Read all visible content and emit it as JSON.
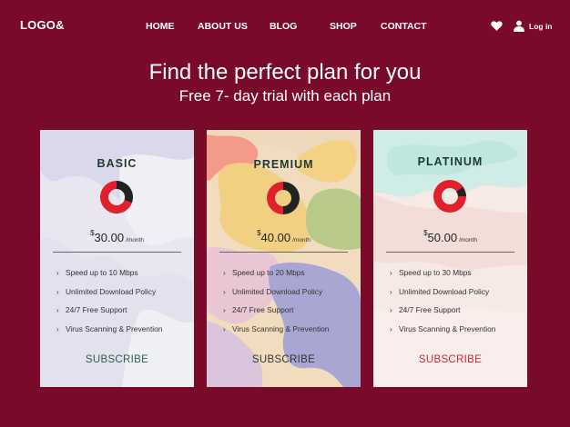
{
  "nav": {
    "logo": "LOGO&",
    "items": [
      "HOME",
      "ABOUT US",
      "BLOG",
      "SHOP",
      "CONTACT"
    ],
    "login": "Log in",
    "icons": [
      "heart-icon",
      "user-icon"
    ]
  },
  "hero": {
    "title": "Find the perfect plan for you",
    "subtitle": "Free 7- day trial with each plan"
  },
  "plans": [
    {
      "name": "BASIC",
      "currency": "$",
      "price": "30.00",
      "period": "/month",
      "features": [
        "Speed up to 10 Mbps",
        "Unlimited Download Policy",
        "24/7 Free Support",
        "Virus Scanning & Prevention"
      ],
      "cta": "SUBSCRIBE",
      "cta_color": "#2f5e4a"
    },
    {
      "name": "PREMIUM",
      "currency": "$",
      "price": "40.00",
      "period": "/month",
      "features": [
        "Speed up to 20 Mbps",
        "Unlimited Download Policy",
        "24/7 Free Support",
        "Virus Scanning & Prevention"
      ],
      "cta": "SUBSCRIBE",
      "cta_color": "#333333"
    },
    {
      "name": "PLATINUM",
      "currency": "$",
      "price": "50.00",
      "period": "/month",
      "features": [
        "Speed up to 30 Mbps",
        "Unlimited Download Policy",
        "24/7 Free Support",
        "Virus Scanning & Prevention"
      ],
      "cta": "SUBSCRIBE",
      "cta_color": "#c8283a"
    }
  ],
  "colors": {
    "background": "#7a0a2a",
    "donut_red": "#e0202a",
    "donut_dark": "#222222"
  }
}
